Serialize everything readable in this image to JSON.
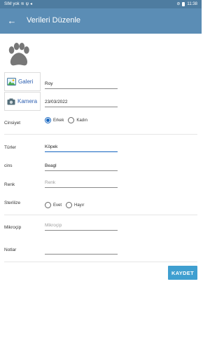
{
  "status_bar": {
    "carrier": "SIM yok",
    "time": "11:38",
    "icons": [
      "wifi-icon",
      "usb-icon",
      "send-icon",
      "alarm-off-icon",
      "battery-icon"
    ]
  },
  "app_bar": {
    "title": "Verileri Düzenle",
    "back_icon": "arrow-left-icon"
  },
  "photo": {
    "placeholder_icon": "paw-icon",
    "gallery_label": "Galeri",
    "camera_label": "Kamera"
  },
  "form": {
    "name_value": "Roy",
    "date_value": "23/03/2022",
    "gender_label": "Cinsiyet",
    "gender_options": [
      "Erkek",
      "Kadın"
    ],
    "gender_selected": "Erkek",
    "species_label": "Türler",
    "species_value": "Köpek",
    "breed_label": "cins",
    "breed_value": "Beagl",
    "color_label": "Renk",
    "color_placeholder": "Renk",
    "sterilize_label": "Sterilize",
    "sterilize_options": [
      "Evet",
      "Hayır"
    ],
    "microchip_label": "Mikroçip",
    "microchip_placeholder": "Mikroçip",
    "notes_label": "Notlar",
    "notes_value": ""
  },
  "actions": {
    "save_label": "KAYDET"
  },
  "colors": {
    "app_bar": "#5b8db5",
    "status_bar": "#4e7ca0",
    "accent": "#1565c0",
    "save_button": "#3f9fd0"
  }
}
